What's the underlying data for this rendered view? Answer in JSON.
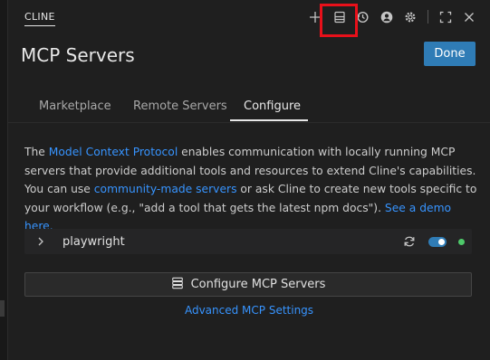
{
  "header": {
    "tab_label": "CLINE",
    "icons": [
      "plus-icon",
      "layout-icon",
      "history-icon",
      "account-icon",
      "gear-icon",
      "fullscreen-icon",
      "close-icon"
    ]
  },
  "page": {
    "title": "MCP Servers",
    "done_label": "Done"
  },
  "tabs": [
    {
      "label": "Marketplace",
      "active": false
    },
    {
      "label": "Remote Servers",
      "active": false
    },
    {
      "label": "Configure",
      "active": true
    }
  ],
  "description": {
    "part1": "The ",
    "link1": "Model Context Protocol",
    "part2": " enables communication with locally running MCP servers that provide additional tools and resources to extend Cline's capabilities. You can use ",
    "link2": "community-made servers",
    "part3": " or ask Cline to create new tools specific to your workflow (e.g., \"add a tool that gets the latest npm docs\"). ",
    "link3": "See a demo here."
  },
  "servers": [
    {
      "name": "playwright",
      "enabled": true,
      "status": "connected"
    }
  ],
  "configure_button": {
    "label": "Configure MCP Servers",
    "icon": "server-icon"
  },
  "advanced_link": "Advanced MCP Settings",
  "colors": {
    "accent": "#2f7cb6",
    "link": "#3794ff",
    "status_ok": "#4ec96a",
    "highlight": "#e8101a"
  }
}
